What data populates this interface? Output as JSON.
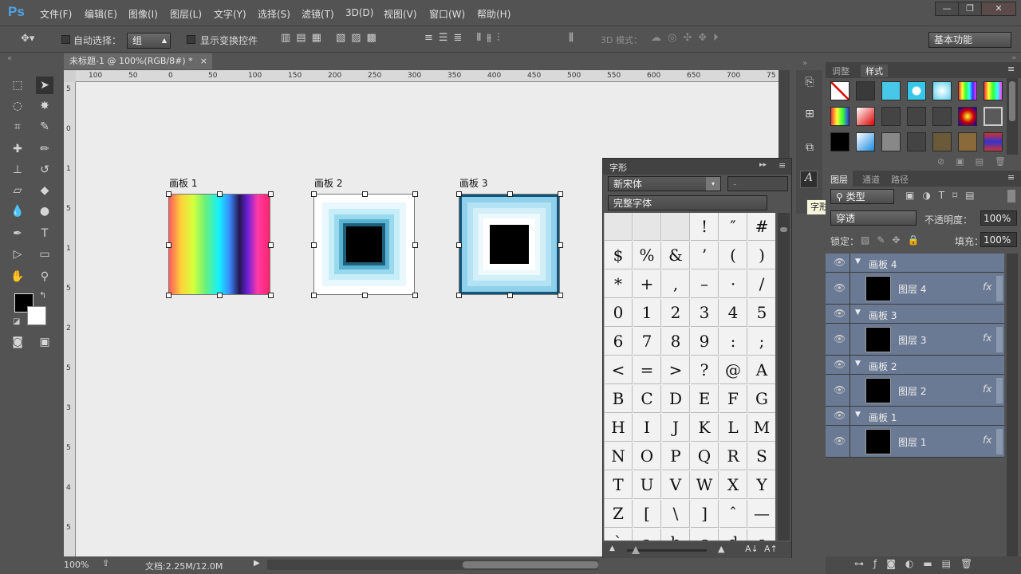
{
  "app": {
    "logo": "Ps"
  },
  "menu": [
    "文件(F)",
    "编辑(E)",
    "图像(I)",
    "图层(L)",
    "文字(Y)",
    "选择(S)",
    "滤镜(T)",
    "3D(D)",
    "视图(V)",
    "窗口(W)",
    "帮助(H)"
  ],
  "window_controls": {
    "minimize": "—",
    "restore": "❐",
    "close": "✕"
  },
  "options": {
    "auto_select_label": "自动选择：",
    "auto_select_value": "组",
    "show_transform_label": "显示变换控件",
    "mode_3d_label": "3D 模式：",
    "workspace": "基本功能"
  },
  "document": {
    "tab_title": "未标题-1 @ 100%(RGB/8#) *",
    "close": "×",
    "ruler_h": [
      "100",
      "50",
      "0",
      "50",
      "100",
      "150",
      "200",
      "250",
      "300",
      "350",
      "400",
      "450",
      "500",
      "550",
      "600",
      "650",
      "700",
      "75"
    ],
    "ruler_v": [
      "5",
      "0",
      "1",
      "5",
      "1",
      "5",
      "2",
      "5",
      "3",
      "5",
      "4",
      "5"
    ],
    "zoom": "100%",
    "doc_info": "文档:2.25M/12.0M"
  },
  "artboards": [
    {
      "label": "画板 1"
    },
    {
      "label": "画板 2"
    },
    {
      "label": "画板 3"
    }
  ],
  "glyphs": {
    "title": "字形",
    "font": "新宋体",
    "style": "-",
    "subset": "完整字体",
    "cells": [
      "",
      "",
      "",
      "!",
      "″",
      "#",
      "$",
      "%",
      "&",
      "’",
      "(",
      ")",
      "*",
      "+",
      ",",
      "–",
      "·",
      "/",
      "0",
      "1",
      "2",
      "3",
      "4",
      "5",
      "6",
      "7",
      "8",
      "9",
      ":",
      ";",
      "<",
      "=",
      ">",
      "?",
      "@",
      "A",
      "B",
      "C",
      "D",
      "E",
      "F",
      "G",
      "H",
      "I",
      "J",
      "K",
      "L",
      "M",
      "N",
      "O",
      "P",
      "Q",
      "R",
      "S",
      "T",
      "U",
      "V",
      "W",
      "X",
      "Y",
      "Z",
      "[",
      "\\",
      "]",
      "ˆ",
      "—",
      "ˋ",
      "a",
      "b",
      "c",
      "d",
      "e"
    ]
  },
  "tooltip": "字形",
  "panels": {
    "top_tabs": [
      "调整",
      "样式"
    ],
    "layer_tabs": [
      "图层",
      "通道",
      "路径"
    ],
    "filter_kind": "类型",
    "blend_mode": "穿透",
    "opacity_label": "不透明度：",
    "opacity": "100%",
    "lock_label": "锁定：",
    "fill_label": "填充：",
    "fill": "100%",
    "layers": [
      {
        "type": "group",
        "name": "画板 4"
      },
      {
        "type": "layer",
        "name": "图层 4"
      },
      {
        "type": "group",
        "name": "画板 3"
      },
      {
        "type": "layer",
        "name": "图层 3"
      },
      {
        "type": "group",
        "name": "画板 2"
      },
      {
        "type": "layer",
        "name": "图层 2"
      },
      {
        "type": "group",
        "name": "画板 1"
      },
      {
        "type": "layer",
        "name": "图层 1"
      }
    ],
    "fx": "fx"
  }
}
